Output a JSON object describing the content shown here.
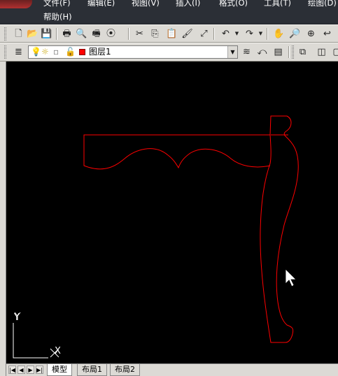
{
  "menu": {
    "row1": [
      "文件(F)",
      "编辑(E)",
      "视图(V)",
      "插入(I)",
      "格式(O)",
      "工具(T)",
      "绘图(D)"
    ],
    "row2": [
      "帮助(H)"
    ]
  },
  "toolbar_standard": {
    "icons": [
      "new-icon",
      "open-icon",
      "save-icon",
      "print-icon",
      "print-preview-icon",
      "publish-icon",
      "plot-icon",
      "cut-icon",
      "copy-icon",
      "paste-icon",
      "match-properties-icon",
      "undo-icon",
      "redo-icon",
      "pan-icon",
      "zoom-realtime-icon",
      "zoom-window-icon",
      "zoom-previous-icon"
    ]
  },
  "layers": {
    "current_layer": "图层1",
    "current_layer_color": "#ff0000"
  },
  "canvas": {
    "background": "#000000",
    "line_color": "#ff0000",
    "ucs_x_label": "X",
    "ucs_y_label": "Y"
  },
  "tabs": {
    "items": [
      "模型",
      "布局1",
      "布局2"
    ],
    "active_index": 0
  }
}
